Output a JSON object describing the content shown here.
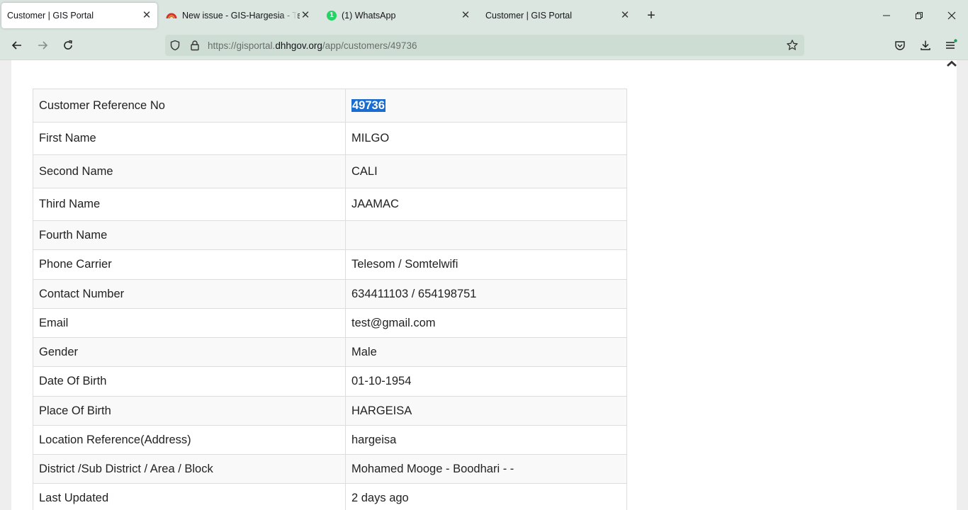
{
  "browser": {
    "tabs": [
      {
        "title": "Customer | GIS Portal",
        "active": true,
        "icon": "none"
      },
      {
        "title": "New issue - GIS-Hargesia - Team",
        "active": false,
        "icon": "gitlab-rainbow-icon"
      },
      {
        "title": "(1) WhatsApp",
        "active": false,
        "icon": "whatsapp-badge-icon",
        "badge": "1"
      },
      {
        "title": "Customer | GIS Portal",
        "active": false,
        "icon": "none"
      }
    ],
    "url": {
      "prefix": "https://gisportal.",
      "domain": "dhhgov.org",
      "path": "/app/customers/49736"
    }
  },
  "customer": {
    "rows": [
      {
        "label": "Customer Reference No",
        "value": "49736",
        "selected": true
      },
      {
        "label": "First Name",
        "value": "MILGO"
      },
      {
        "label": "Second Name",
        "value": "CALI"
      },
      {
        "label": "Third Name",
        "value": "JAAMAC"
      },
      {
        "label": "Fourth Name",
        "value": ""
      },
      {
        "label": "Phone Carrier",
        "value": "Telesom / Somtelwifi"
      },
      {
        "label": "Contact Number",
        "value": "634411103 / 654198751"
      },
      {
        "label": "Email",
        "value": "test@gmail.com"
      },
      {
        "label": "Gender",
        "value": "Male"
      },
      {
        "label": "Date Of Birth",
        "value": "01-10-1954"
      },
      {
        "label": "Place Of Birth",
        "value": "HARGEISA"
      },
      {
        "label": "Location Reference(Address)",
        "value": "hargeisa"
      },
      {
        "label": "District /Sub District / Area / Block",
        "value": "Mohamed Mooge - Boodhari - -"
      },
      {
        "label": "Last Updated",
        "value": "2 days ago"
      }
    ]
  },
  "colors": {
    "chrome_bg": "#dce6e0",
    "url_bg": "#cdddd4",
    "selection": "#1a6cd0",
    "whatsapp_green": "#25d366"
  }
}
